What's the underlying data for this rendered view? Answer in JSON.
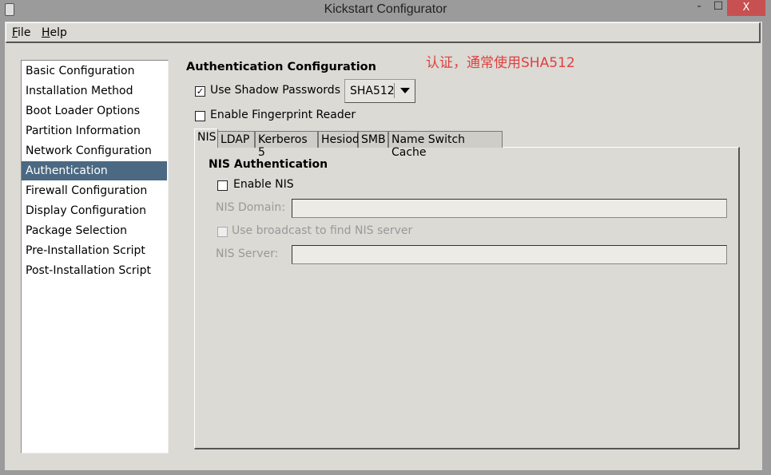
{
  "window": {
    "title": "Kickstart Configurator",
    "minimize": "-",
    "maximize": "☐",
    "close": "X"
  },
  "menu": [
    {
      "label": "File",
      "mnemonic": "F",
      "rest": "ile"
    },
    {
      "label": "Help",
      "mnemonic": "H",
      "rest": "elp"
    }
  ],
  "sidebar": {
    "selected": "Authentication",
    "items": [
      "Basic Configuration",
      "Installation Method",
      "Boot Loader Options",
      "Partition Information",
      "Network Configuration",
      "Authentication",
      "Firewall Configuration",
      "Display Configuration",
      "Package Selection",
      "Pre-Installation Script",
      "Post-Installation Script"
    ]
  },
  "main": {
    "heading": "Authentication Configuration",
    "annotation": "认证，通常使用SHA512",
    "annotation_color": "#e04040",
    "shadow": {
      "label": "Use Shadow Passwords",
      "checked": true,
      "check_glyph": "✓"
    },
    "hash_combo": {
      "value": "SHA512"
    },
    "fingerprint": {
      "label": "Enable Fingerprint Reader",
      "checked": false
    },
    "tabs": [
      "NIS",
      "LDAP",
      "Kerberos 5",
      "Hesiod",
      "SMB",
      "Name Switch Cache"
    ],
    "active_tab": "NIS",
    "nis": {
      "title": "NIS Authentication",
      "enable_label": "Enable NIS",
      "enable_checked": false,
      "domain_label": "NIS Domain:",
      "domain_value": "",
      "broadcast_label": "Use broadcast to find NIS server",
      "server_label": "NIS Server:",
      "server_value": ""
    }
  },
  "colors": {
    "selection": "#4b6983",
    "window_bg": "#dcdad5",
    "close_button": "#c75050"
  }
}
